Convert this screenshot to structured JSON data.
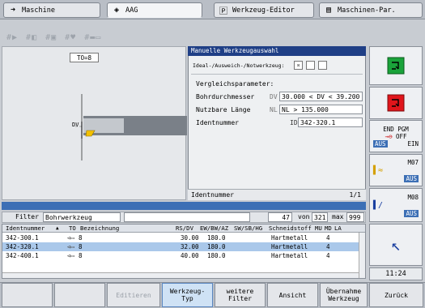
{
  "tabs": [
    {
      "label": "Maschine"
    },
    {
      "label": "AAG"
    },
    {
      "label": "Werkzeug-Editor"
    },
    {
      "label": "Maschinen-Par."
    }
  ],
  "graphic": {
    "to_label": "TO=8",
    "dv_label": "DV"
  },
  "dialog": {
    "title": "Manuelle Werkzeugauswahl",
    "ideal_label": "Ideal-/Ausweich-/Notwerkzeug:",
    "section_label": "Vergleichsparameter:",
    "bohr_label": "Bohrdurchmesser",
    "bohr_code": "DV",
    "bohr_value": "30.000 < DV < 39.200",
    "laenge_label": "Nutzbare Länge",
    "laenge_code": "NL",
    "laenge_value": "NL > 135.000",
    "ident_label": "Identnummer",
    "ident_code": "ID",
    "ident_value": "342-320.1"
  },
  "status": {
    "label": "Identnummer",
    "page": "1/1"
  },
  "filter": {
    "label": "Filter",
    "value": "Bohrwerkzeug",
    "count": "47",
    "von_label": "von",
    "total": "321",
    "max_label": "max",
    "max": "999"
  },
  "table": {
    "headers": [
      "Identnummer",
      "TO",
      "Bezeichnung",
      "RS/DV",
      "EW/BW/AZ",
      "SW/SB/HG",
      "Schneidstoff",
      "MU",
      "MD",
      "LA"
    ],
    "rows": [
      {
        "id": "342-300.1",
        "to": "8",
        "rs": "30.00",
        "ew": "180.0",
        "mat": "Hartmetall",
        "md": "4"
      },
      {
        "id": "342-320.1",
        "to": "8",
        "rs": "32.00",
        "ew": "180.0",
        "mat": "Hartmetall",
        "md": "4"
      },
      {
        "id": "342-400.1",
        "to": "8",
        "rs": "40.00",
        "ew": "180.0",
        "mat": "Hartmetall",
        "md": "4"
      }
    ]
  },
  "side": {
    "endpgm": "END PGM",
    "off": "OFF",
    "aus": "AUS",
    "ein": "EIN",
    "m07": "M07",
    "m07_state": "AUS",
    "m08": "M08",
    "m08_state": "AUS"
  },
  "clock": "11:24",
  "softkeys": {
    "editieren": "Editieren",
    "werkzeugtyp": "Werkzeug-\nTyp",
    "weiterefilter": "weitere\nFilter",
    "ansicht": "Ansicht",
    "uebernahme": "Übernahme\nWerkzeug",
    "zurueck": "Zurück"
  },
  "colors": {
    "accent": "#1f3f86",
    "selection": "#aac8ea",
    "bar": "#3c6fb5"
  }
}
